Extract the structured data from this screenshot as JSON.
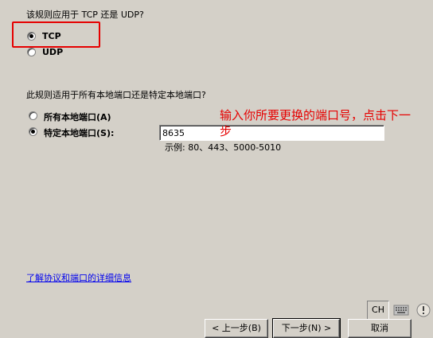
{
  "protocol_section": {
    "question": "该规则应用于 TCP 还是 UDP?",
    "options": [
      {
        "label": "TCP",
        "selected": true
      },
      {
        "label": "UDP",
        "selected": false
      }
    ]
  },
  "port_section": {
    "question": "此规则适用于所有本地端口还是特定本地端口?",
    "options": [
      {
        "label": "所有本地端口(A)",
        "selected": false
      },
      {
        "label": "特定本地端口(S):",
        "selected": true
      }
    ],
    "port_value": "8635",
    "example_text": "示例: 80、443、5000-5010"
  },
  "annotation": {
    "line1": "输入你所要更换的端口号，点击下一",
    "line2": "步",
    "color": "#e60000"
  },
  "help_link": "了解协议和端口的详细信息",
  "taskbar": {
    "lang": "CH",
    "keyboard_icon": "keyboard-icon"
  },
  "buttons": {
    "back": "< 上一步(B)",
    "next": "下一步(N) >",
    "cancel": "取消"
  }
}
